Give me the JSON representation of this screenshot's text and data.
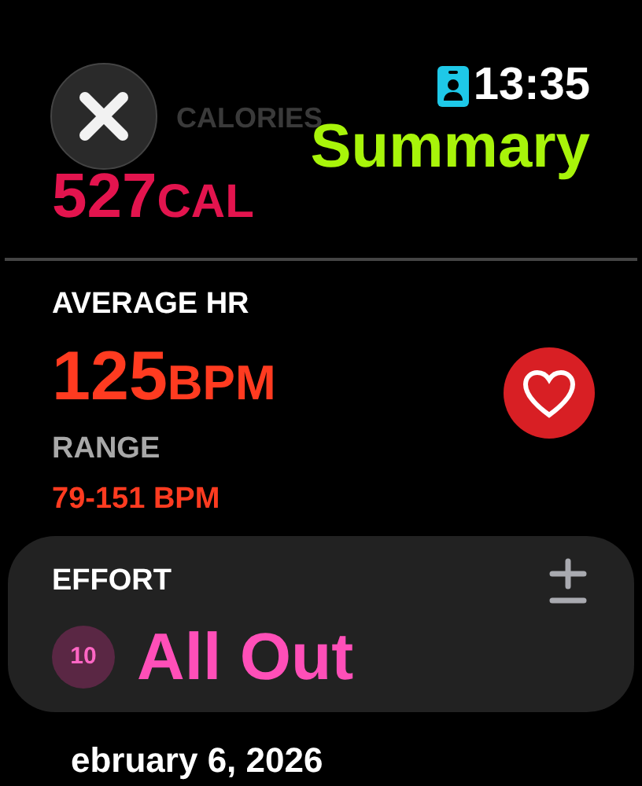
{
  "status": {
    "time": "13:35"
  },
  "title": "Summary",
  "calories": {
    "label": "CALORIES",
    "value": "527",
    "unit": "CAL"
  },
  "heart_rate": {
    "label": "AVERAGE HR",
    "value": "125",
    "unit": "BPM",
    "range_label": "RANGE",
    "range": "79-151 BPM"
  },
  "effort": {
    "label": "EFFORT",
    "score": "10",
    "rating": "All Out"
  },
  "date": "ebruary 6, 2026"
}
